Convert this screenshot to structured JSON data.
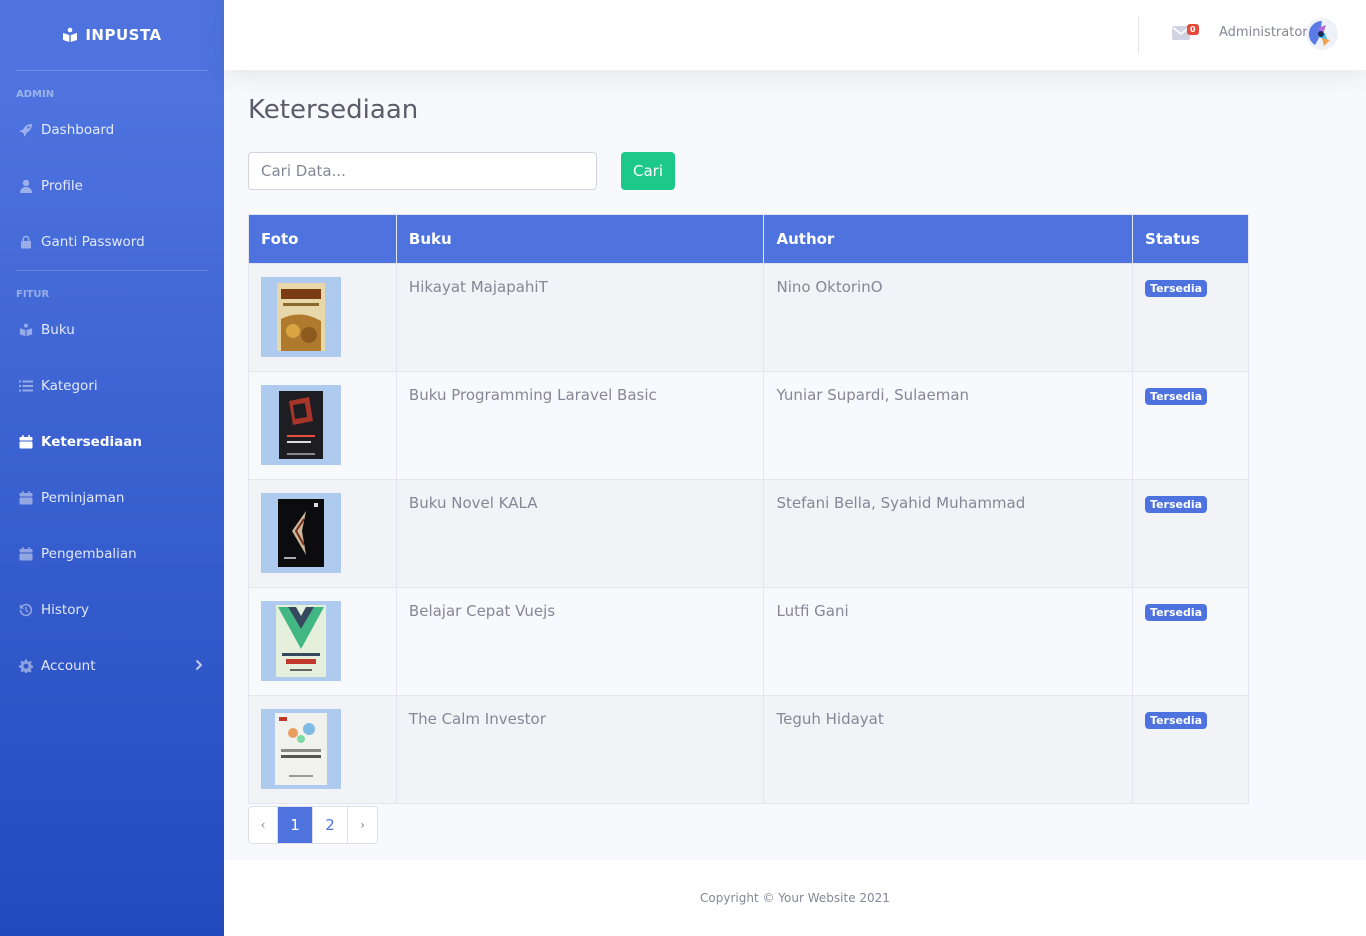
{
  "brand": {
    "name": "INPUSTA",
    "icon": "book-reader-icon"
  },
  "sidebar": {
    "sections": [
      {
        "heading": "Admin",
        "items": [
          {
            "label": "Dashboard",
            "icon": "rocket-icon"
          },
          {
            "label": "Profile",
            "icon": "user-icon"
          },
          {
            "label": "Ganti Password",
            "icon": "lock-icon"
          }
        ]
      },
      {
        "heading": "Fitur",
        "items": [
          {
            "label": "Buku",
            "icon": "book-reader-icon"
          },
          {
            "label": "Kategori",
            "icon": "list-icon"
          },
          {
            "label": "Ketersediaan",
            "icon": "calendar-icon",
            "active": true
          },
          {
            "label": "Peminjaman",
            "icon": "calendar-icon"
          },
          {
            "label": "Pengembalian",
            "icon": "calendar-icon"
          },
          {
            "label": "History",
            "icon": "history-icon"
          },
          {
            "label": "Account",
            "icon": "gear-icon"
          }
        ]
      }
    ]
  },
  "topbar": {
    "message_count": "0",
    "username": "Administrator"
  },
  "page": {
    "title": "Ketersediaan"
  },
  "search": {
    "placeholder": "Cari Data...",
    "button_label": "Cari"
  },
  "table": {
    "headers": [
      "Foto",
      "Buku",
      "Author",
      "Status"
    ],
    "rows": [
      {
        "buku": "Hikayat MajapahiT",
        "author": "Nino OktorinO",
        "status": "Tersedia"
      },
      {
        "buku": "Buku Programming Laravel Basic",
        "author": "Yuniar Supardi, Sulaeman",
        "status": "Tersedia"
      },
      {
        "buku": "Buku Novel KALA",
        "author": "Stefani Bella, Syahid Muhammad",
        "status": "Tersedia"
      },
      {
        "buku": "Belajar Cepat Vuejs",
        "author": "Lutfi Gani",
        "status": "Tersedia"
      },
      {
        "buku": "The Calm Investor",
        "author": "Teguh Hidayat",
        "status": "Tersedia"
      }
    ]
  },
  "pagination": {
    "prev": "‹",
    "pages": [
      "1",
      "2"
    ],
    "current": "1",
    "next": "›"
  },
  "footer": {
    "copyright": "Copyright © Your Website 2021"
  },
  "colors": {
    "primary": "#4e73df",
    "success": "#1cc88a",
    "danger": "#e74a3b"
  }
}
